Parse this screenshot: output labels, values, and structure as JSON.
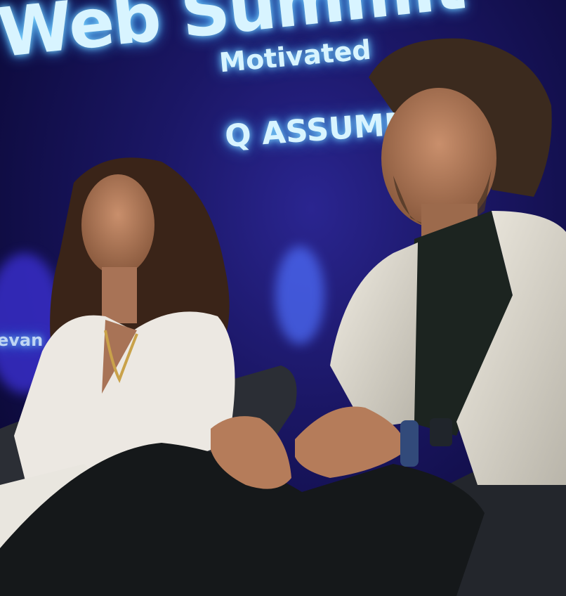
{
  "screen": {
    "title": "Web Summit",
    "line1": "Motivated",
    "line2": "Q ASSUME",
    "side": "evan"
  },
  "colors": {
    "backdrop": "#1b1766",
    "screen_text": "#d8f4ff",
    "jacket": "#e6e2d8",
    "shirt": "#1c2420",
    "trousers": "#15181a"
  }
}
